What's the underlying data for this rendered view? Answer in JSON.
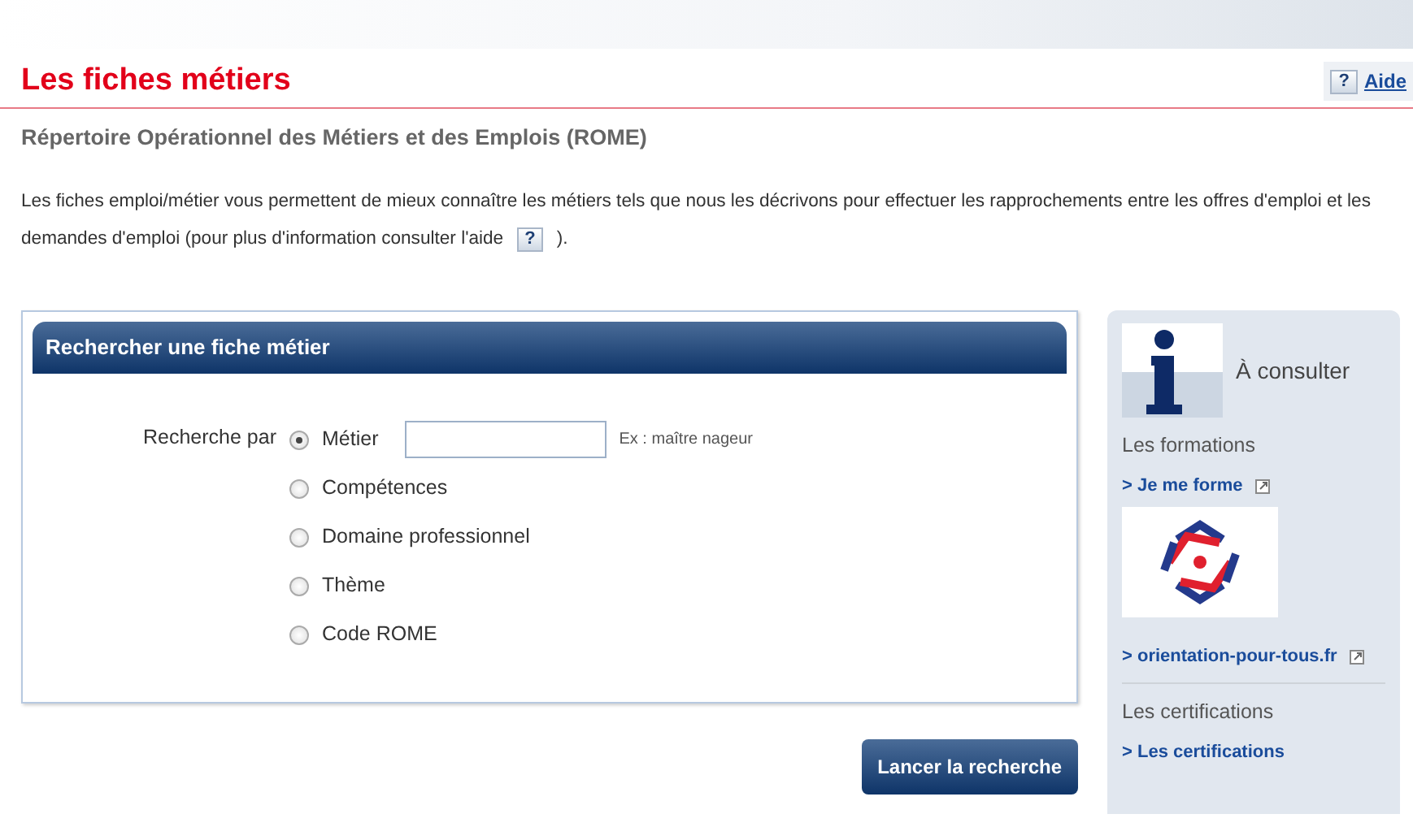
{
  "page": {
    "title": "Les fiches métiers",
    "help_link": "Aide",
    "help_icon": "?",
    "subtitle": "Répertoire Opérationnel des Métiers et des Emplois (ROME)",
    "intro": [
      "Les fiches emploi/métier vous permettent de mieux connaître les métiers tels que nous les décrivons pour effectuer les rapprochements entre les offres d'emploi et les",
      "demandes d'emploi (pour plus d'information consulter l'aide"
    ],
    "intro_icon": "?",
    "intro_end": ")."
  },
  "search_panel": {
    "title": "Rechercher une fiche métier",
    "label": "Recherche par",
    "example": "Ex : maître nageur",
    "options": [
      {
        "label": "Métier",
        "selected": true
      },
      {
        "label": "Compétences",
        "selected": false
      },
      {
        "label": "Domaine professionnel",
        "selected": false
      },
      {
        "label": "Thème",
        "selected": false
      },
      {
        "label": "Code ROME",
        "selected": false
      }
    ],
    "button": "Lancer la recherche"
  },
  "sidebar": {
    "title": "À consulter",
    "items": [
      {
        "kind": "heading",
        "text": "Les formations"
      },
      {
        "kind": "link",
        "text": "> Je me forme",
        "external": true
      },
      {
        "kind": "logo"
      },
      {
        "kind": "link",
        "text": "> orientation-pour-tous.fr",
        "external": true
      },
      {
        "kind": "divider"
      },
      {
        "kind": "heading",
        "text": "Les certifications"
      },
      {
        "kind": "link",
        "text": "> Les certifications",
        "external": false
      }
    ]
  }
}
